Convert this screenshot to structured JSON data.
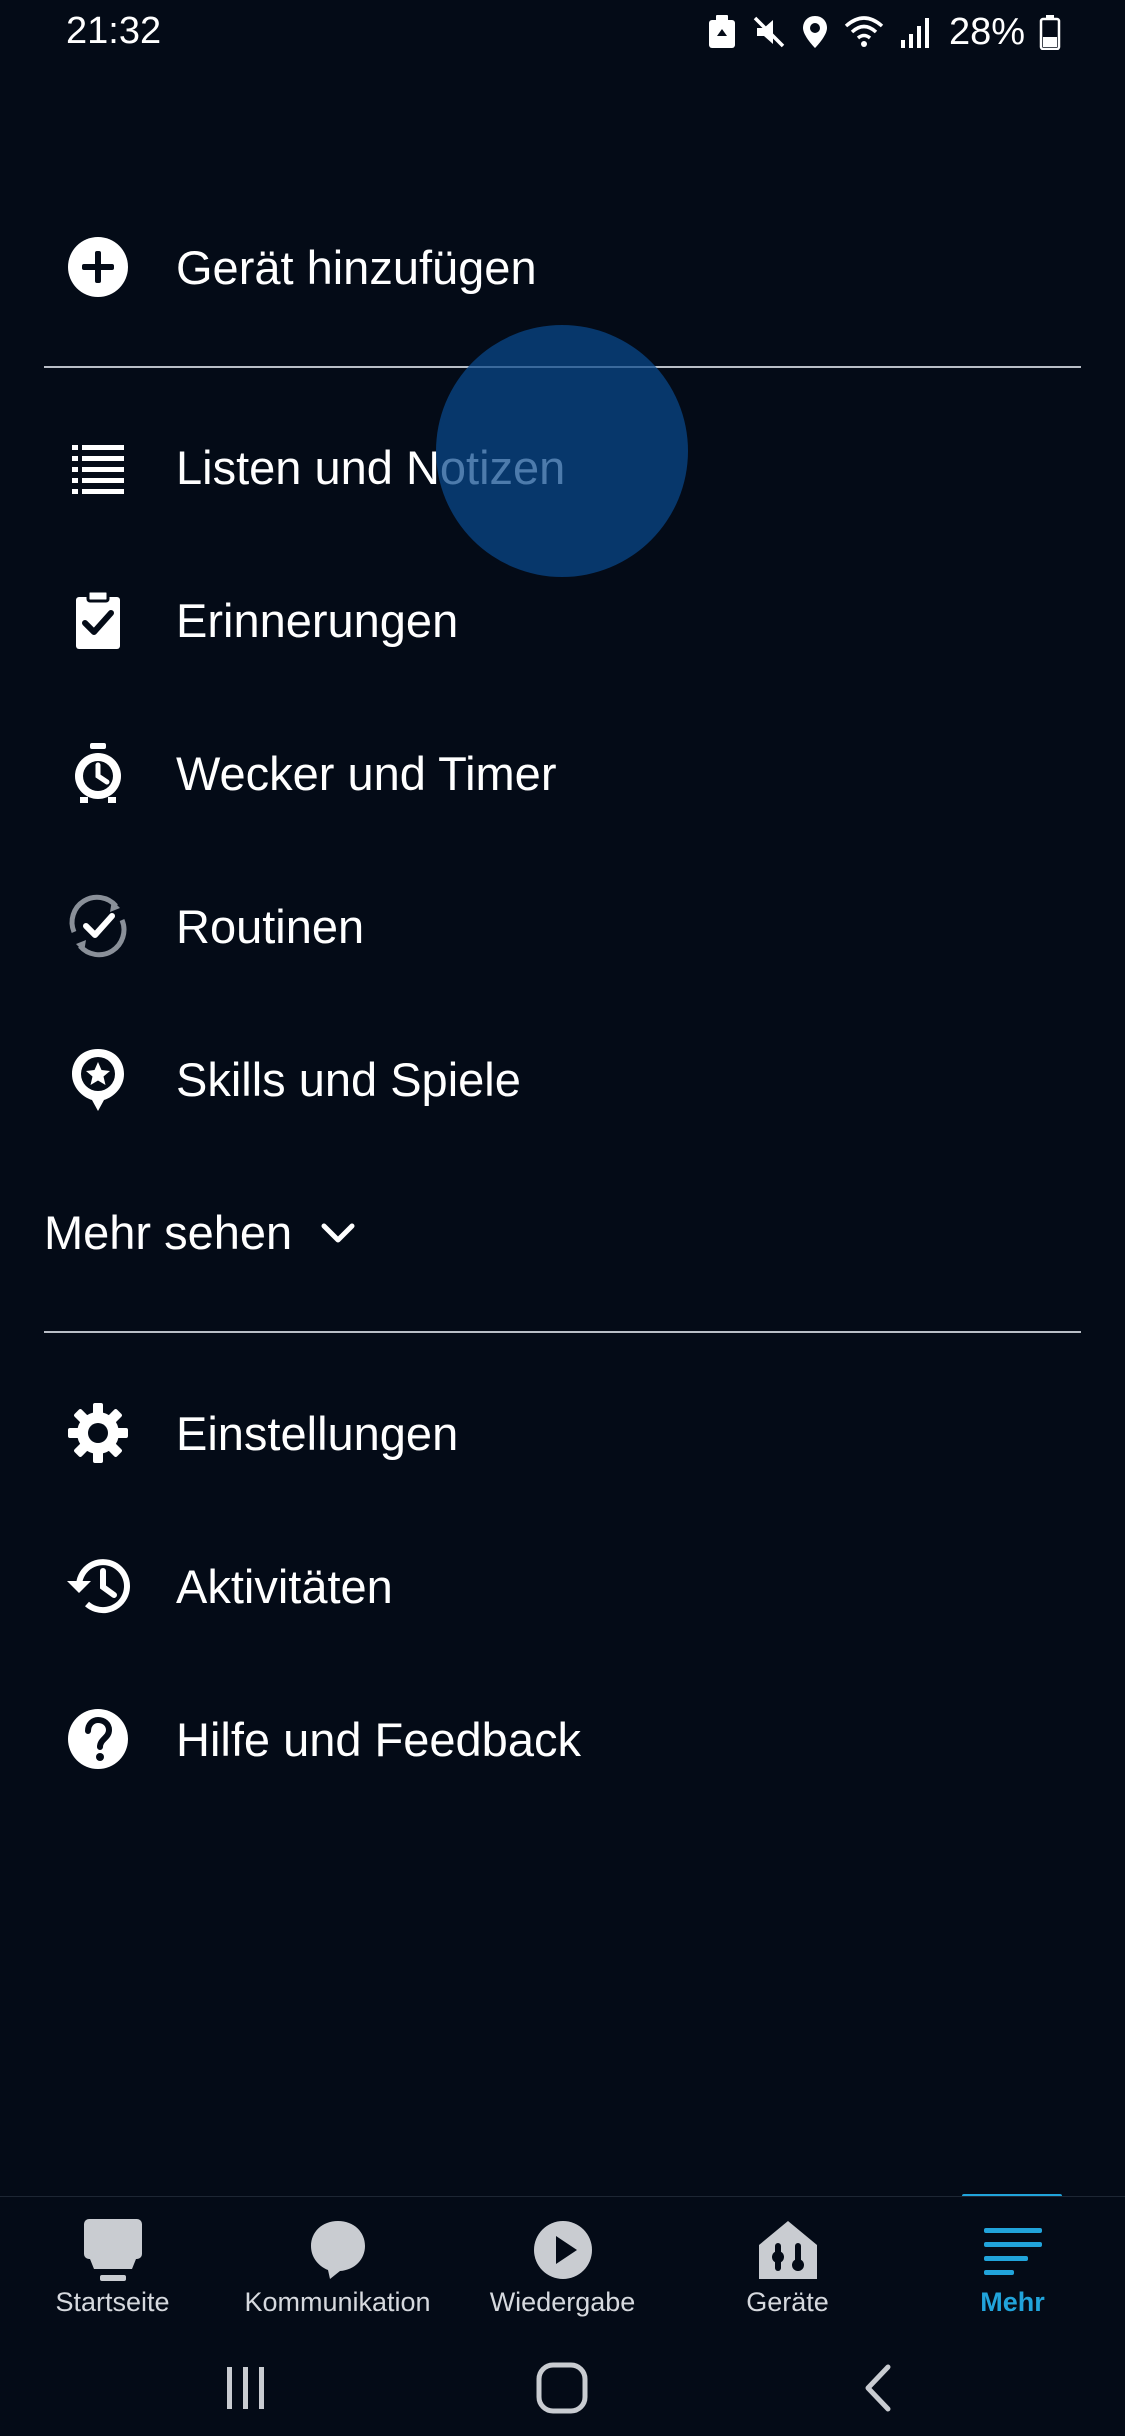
{
  "status_bar": {
    "time": "21:32",
    "battery": "28%",
    "icons": [
      "recycle-icon",
      "mute-icon",
      "location-icon",
      "wifi-icon",
      "signal-icon",
      "battery-icon"
    ]
  },
  "menu": {
    "add_device": {
      "label": "Gerät hinzufügen",
      "icon": "plus-circle-icon"
    },
    "items": [
      {
        "label": "Listen und Notizen",
        "icon": "list-icon"
      },
      {
        "label": "Erinnerungen",
        "icon": "clipboard-check-icon"
      },
      {
        "label": "Wecker und Timer",
        "icon": "alarm-clock-icon"
      },
      {
        "label": "Routinen",
        "icon": "routine-cycle-icon"
      },
      {
        "label": "Skills und Spiele",
        "icon": "skills-star-icon"
      }
    ],
    "see_more": "Mehr sehen",
    "bottom_items": [
      {
        "label": "Einstellungen",
        "icon": "gear-icon"
      },
      {
        "label": "Aktivitäten",
        "icon": "history-icon"
      },
      {
        "label": "Hilfe und Feedback",
        "icon": "help-icon"
      }
    ]
  },
  "tabs": [
    {
      "label": "Startseite",
      "icon": "home-icon",
      "active": false
    },
    {
      "label": "Kommunikation",
      "icon": "chat-bubble-icon",
      "active": false
    },
    {
      "label": "Wiedergabe",
      "icon": "play-icon",
      "active": false
    },
    {
      "label": "Geräte",
      "icon": "devices-icon",
      "active": false
    },
    {
      "label": "Mehr",
      "icon": "menu-lines-icon",
      "active": true
    }
  ],
  "colors": {
    "background": "#040b17",
    "text": "#ffffff",
    "accent": "#21a4db",
    "divider": "#b9bec6",
    "tab_label": "#d6d9de",
    "ripple": "#08488c"
  },
  "nav_bar": [
    "recent-apps-icon",
    "home-nav-icon",
    "back-icon"
  ]
}
